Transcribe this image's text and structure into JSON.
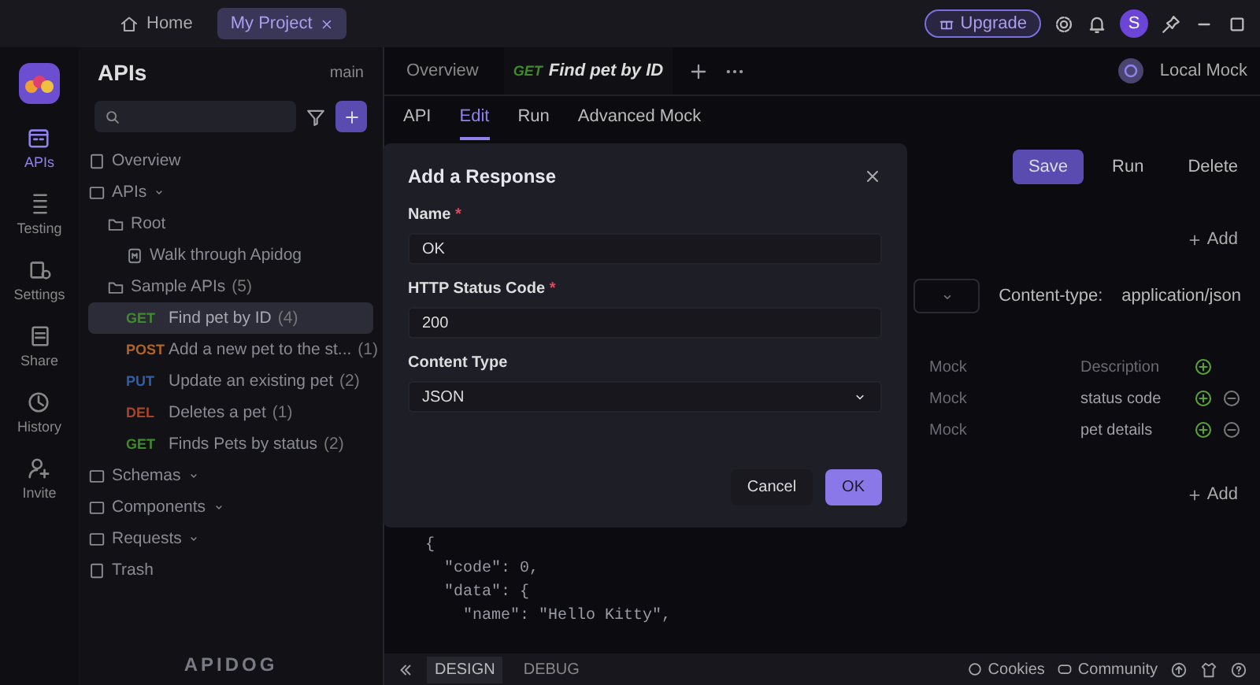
{
  "title_bar": {
    "tabs": [
      {
        "label": "Home",
        "selected": false
      },
      {
        "label": "My Project",
        "selected": true
      }
    ],
    "upgrade": "Upgrade",
    "avatar": "S"
  },
  "rail": [
    {
      "label": "APIs",
      "selected": true
    },
    {
      "label": "Testing",
      "selected": false
    },
    {
      "label": "Settings",
      "selected": false
    },
    {
      "label": "Share",
      "selected": false
    },
    {
      "label": "History",
      "selected": false
    },
    {
      "label": "Invite",
      "selected": false
    }
  ],
  "sidebar": {
    "title": "APIs",
    "branch": "main",
    "footer_logo": "APIDOG",
    "tree": [
      {
        "kind": "page",
        "label": "Overview"
      },
      {
        "kind": "group",
        "label": "APIs",
        "children": [
          {
            "kind": "folder",
            "label": "Root",
            "children": [
              {
                "kind": "doc",
                "label": "Walk through Apidog"
              }
            ]
          },
          {
            "kind": "folder",
            "label": "Sample APIs",
            "count": "(5)",
            "children": [
              {
                "kind": "endpoint",
                "method": "GET",
                "color": "#3f8a2c",
                "label": "Find pet by ID",
                "count": "(4)",
                "selected": true
              },
              {
                "kind": "endpoint",
                "method": "POST",
                "color": "#b0642a",
                "label": "Add a new pet to the st...",
                "count": "(1)",
                "selected": false
              },
              {
                "kind": "endpoint",
                "method": "PUT",
                "color": "#2f5fa8",
                "label": "Update an existing pet",
                "count": "(2)",
                "selected": false
              },
              {
                "kind": "endpoint",
                "method": "DEL",
                "color": "#a8442e",
                "label": "Deletes a pet",
                "count": "(1)",
                "selected": false
              },
              {
                "kind": "endpoint",
                "method": "GET",
                "color": "#3f8a2c",
                "label": "Finds Pets by status",
                "count": "(2)",
                "selected": false
              }
            ]
          }
        ]
      },
      {
        "kind": "group",
        "label": "Schemas"
      },
      {
        "kind": "group",
        "label": "Components"
      },
      {
        "kind": "group",
        "label": "Requests"
      },
      {
        "kind": "page",
        "label": "Trash"
      }
    ]
  },
  "doc_tabs": [
    {
      "kind": "page",
      "label": "Overview",
      "selected": false
    },
    {
      "kind": "endpoint",
      "method": "GET",
      "color": "#3f8a2c",
      "label": "Find pet by ID",
      "selected": true
    }
  ],
  "environment": "Local Mock",
  "sub_tabs": [
    {
      "label": "API",
      "selected": false
    },
    {
      "label": "Edit",
      "selected": true
    },
    {
      "label": "Run",
      "selected": false
    },
    {
      "label": "Advanced Mock",
      "selected": false
    }
  ],
  "actions": [
    "Save",
    "Run",
    "Delete"
  ],
  "add_label": "Add",
  "content_type": {
    "label": "Content-type:",
    "value": "application/json"
  },
  "field_rows": [
    {
      "mock": "Mock",
      "description": {
        "placeholder": "Description"
      },
      "removable": false
    },
    {
      "mock": "Mock",
      "description": {
        "value": "status code"
      },
      "removable": true
    },
    {
      "mock": "Mock",
      "description": {
        "value": "pet details"
      },
      "removable": true
    }
  ],
  "add_label_2": "Add",
  "code_lines": [
    "{",
    "  \"code\": 0,",
    "  \"data\": {",
    "    \"name\": \"Hello Kitty\","
  ],
  "footer": {
    "modes": [
      {
        "label": "DESIGN",
        "selected": true
      },
      {
        "label": "DEBUG",
        "selected": false
      }
    ],
    "links": [
      "Cookies",
      "Community"
    ]
  },
  "modal": {
    "title": "Add a Response",
    "fields": [
      {
        "kind": "input",
        "label": "Name",
        "required_mark": "*",
        "value": "OK"
      },
      {
        "kind": "input",
        "label": "HTTP Status Code",
        "required_mark": "*",
        "value": "200"
      },
      {
        "kind": "select",
        "label": "Content Type",
        "value": "JSON"
      }
    ],
    "buttons": [
      {
        "kind": "secondary",
        "label": "Cancel"
      },
      {
        "kind": "primary",
        "label": "OK"
      }
    ]
  }
}
